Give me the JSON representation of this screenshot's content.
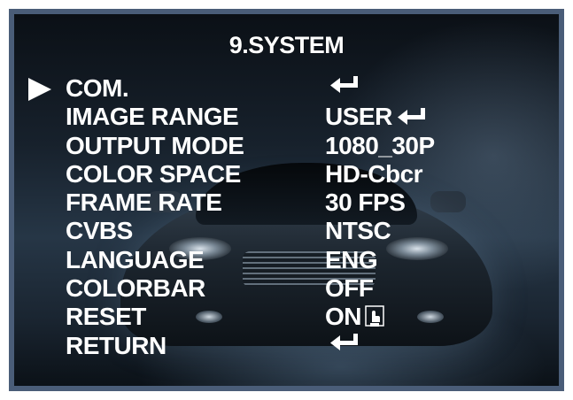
{
  "menu": {
    "title": "9.SYSTEM",
    "selected_index": 0,
    "items": [
      {
        "label": "COM.",
        "value": "",
        "icon": "enter-icon"
      },
      {
        "label": "IMAGE RANGE",
        "value": "USER",
        "icon": "enter-icon"
      },
      {
        "label": "OUTPUT MODE",
        "value": "1080_30P",
        "icon": ""
      },
      {
        "label": "COLOR SPACE",
        "value": "HD-Cbcr",
        "icon": ""
      },
      {
        "label": "FRAME RATE",
        "value": "30 FPS",
        "icon": ""
      },
      {
        "label": "CVBS",
        "value": "NTSC",
        "icon": ""
      },
      {
        "label": "LANGUAGE",
        "value": "ENG",
        "icon": ""
      },
      {
        "label": "COLORBAR",
        "value": "OFF",
        "icon": ""
      },
      {
        "label": "RESET",
        "value": "ON",
        "icon": "hand-press-icon"
      },
      {
        "label": "RETURN",
        "value": "",
        "icon": "enter-icon"
      }
    ]
  },
  "colors": {
    "frame": "#4a5d78",
    "text": "#ffffff",
    "cursor": "#ffffff"
  }
}
